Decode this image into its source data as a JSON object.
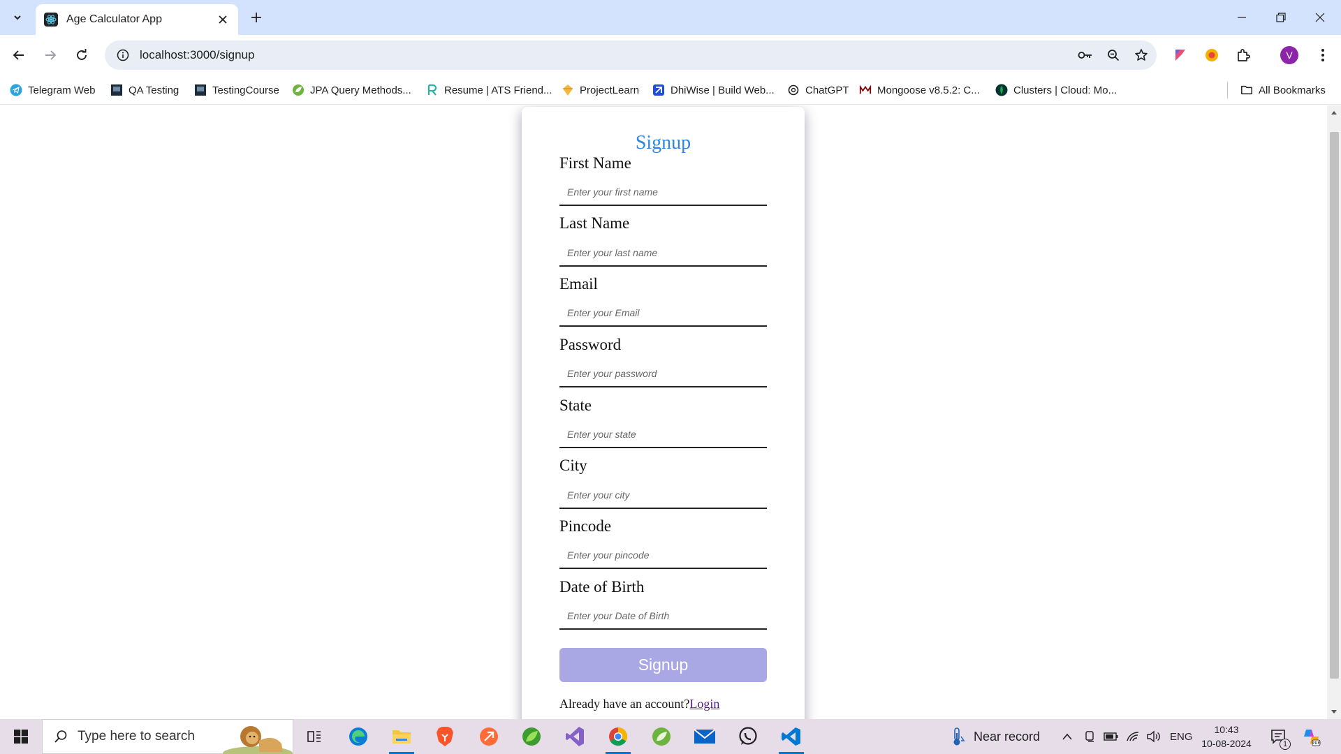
{
  "browser": {
    "tab_title": "Age Calculator App",
    "url": "localhost:3000/signup",
    "profile_initial": "V"
  },
  "bookmarks": [
    {
      "label": "Telegram Web",
      "icon": "telegram-icon"
    },
    {
      "label": "QA Testing",
      "icon": "bookmark-favicon"
    },
    {
      "label": "TestingCourse",
      "icon": "bookmark-favicon"
    },
    {
      "label": "JPA Query Methods...",
      "icon": "spring-icon"
    },
    {
      "label": "Resume | ATS Friend...",
      "icon": "resume-icon"
    },
    {
      "label": "ProjectLearn",
      "icon": "projectlearn-icon"
    },
    {
      "label": "DhiWise | Build Web...",
      "icon": "dhiwise-icon"
    },
    {
      "label": "ChatGPT",
      "icon": "chatgpt-icon"
    },
    {
      "label": "Mongoose v8.5.2: C...",
      "icon": "mongoose-icon"
    },
    {
      "label": "Clusters | Cloud: Mo...",
      "icon": "mongodb-icon"
    }
  ],
  "all_bookmarks_label": "All Bookmarks",
  "form": {
    "title": "Signup",
    "fields": [
      {
        "label": "First Name",
        "placeholder": "Enter your first name"
      },
      {
        "label": "Last Name",
        "placeholder": "Enter your last name"
      },
      {
        "label": "Email",
        "placeholder": "Enter your Email"
      },
      {
        "label": "Password",
        "placeholder": "Enter your password"
      },
      {
        "label": "State",
        "placeholder": "Enter your state"
      },
      {
        "label": "City",
        "placeholder": "Enter your city"
      },
      {
        "label": "Pincode",
        "placeholder": "Enter your pincode"
      },
      {
        "label": "Date of Birth",
        "placeholder": "Enter your Date of Birth"
      }
    ],
    "submit_label": "Signup",
    "login_prompt": "Already have an account?",
    "login_link": "Login"
  },
  "taskbar": {
    "search_placeholder": "Type here to search",
    "weather": "Near record",
    "language": "ENG",
    "time": "10:43",
    "date": "10-08-2024",
    "notification_count": "1"
  },
  "colors": {
    "tabstrip": "#d3e3fd",
    "form_title": "#2e86de",
    "signup_button": "#a9a8e4",
    "login_link": "#551a8b"
  }
}
